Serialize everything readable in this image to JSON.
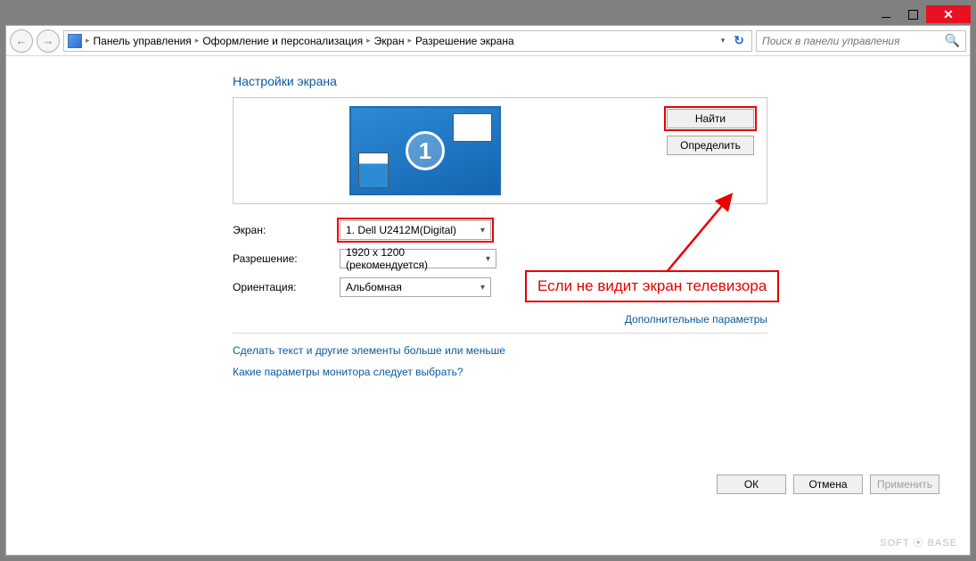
{
  "breadcrumb": {
    "items": [
      "Панель управления",
      "Оформление и персонализация",
      "Экран",
      "Разрешение экрана"
    ]
  },
  "search": {
    "placeholder": "Поиск в панели управления"
  },
  "page_title": "Настройки экрана",
  "preview": {
    "monitor_number": "1",
    "find_label": "Найти",
    "detect_label": "Определить"
  },
  "form": {
    "screen_label": "Экран:",
    "screen_value": "1. Dell U2412M(Digital)",
    "resolution_label": "Разрешение:",
    "resolution_value": "1920 x 1200 (рекомендуется)",
    "orientation_label": "Ориентация:",
    "orientation_value": "Альбомная"
  },
  "advanced_link": "Дополнительные параметры",
  "link1": "Сделать текст и другие элементы больше или меньше",
  "link2": "Какие параметры монитора следует выбрать?",
  "buttons": {
    "ok": "ОК",
    "cancel": "Отмена",
    "apply": "Применить"
  },
  "callout_text": "Если не видит экран телевизора",
  "watermark": "SOFT ⦿ BASE"
}
